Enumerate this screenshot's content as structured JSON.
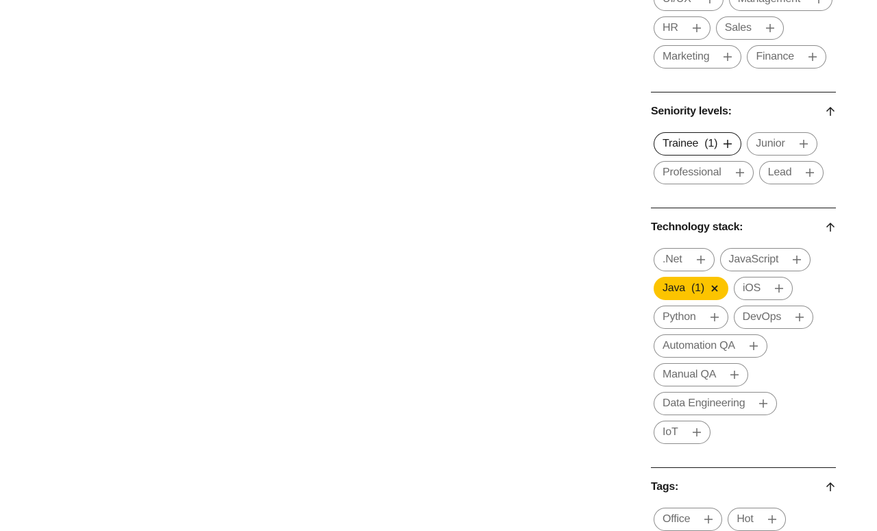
{
  "departments": {
    "chips": [
      {
        "label": "UI/UX",
        "state": "default"
      },
      {
        "label": "Management",
        "state": "default"
      },
      {
        "label": "HR",
        "state": "default"
      },
      {
        "label": "Sales",
        "state": "default"
      },
      {
        "label": "Marketing",
        "state": "default"
      },
      {
        "label": "Finance",
        "state": "default"
      }
    ]
  },
  "seniority": {
    "title": "Seniority levels:",
    "chips": [
      {
        "label": "Trainee",
        "count": "(1)",
        "state": "selected-outline"
      },
      {
        "label": "Junior",
        "state": "default"
      },
      {
        "label": "Professional",
        "state": "default"
      },
      {
        "label": "Lead",
        "state": "default"
      }
    ]
  },
  "technology": {
    "title": "Technology stack:",
    "chips": [
      {
        "label": ".Net",
        "state": "default"
      },
      {
        "label": "JavaScript",
        "state": "default"
      },
      {
        "label": "Java",
        "count": "(1)",
        "state": "selected-filled"
      },
      {
        "label": "iOS",
        "state": "default"
      },
      {
        "label": "Python",
        "state": "default"
      },
      {
        "label": "DevOps",
        "state": "default"
      },
      {
        "label": "Automation QA",
        "state": "default"
      },
      {
        "label": "Manual QA",
        "state": "default"
      },
      {
        "label": "Data Engineering",
        "state": "default"
      },
      {
        "label": "IoT",
        "state": "default"
      }
    ]
  },
  "tags": {
    "title": "Tags:",
    "chips": [
      {
        "label": "Office",
        "state": "default"
      },
      {
        "label": "Hot",
        "state": "default"
      }
    ]
  },
  "colors": {
    "accent": "#fcc400",
    "border": "#8c8c8c",
    "text": "#1a1a1a",
    "muted_text": "#6b6b6b"
  },
  "icons": {
    "add": "plus-icon",
    "remove": "close-icon",
    "collapse": "arrow-up-icon"
  }
}
